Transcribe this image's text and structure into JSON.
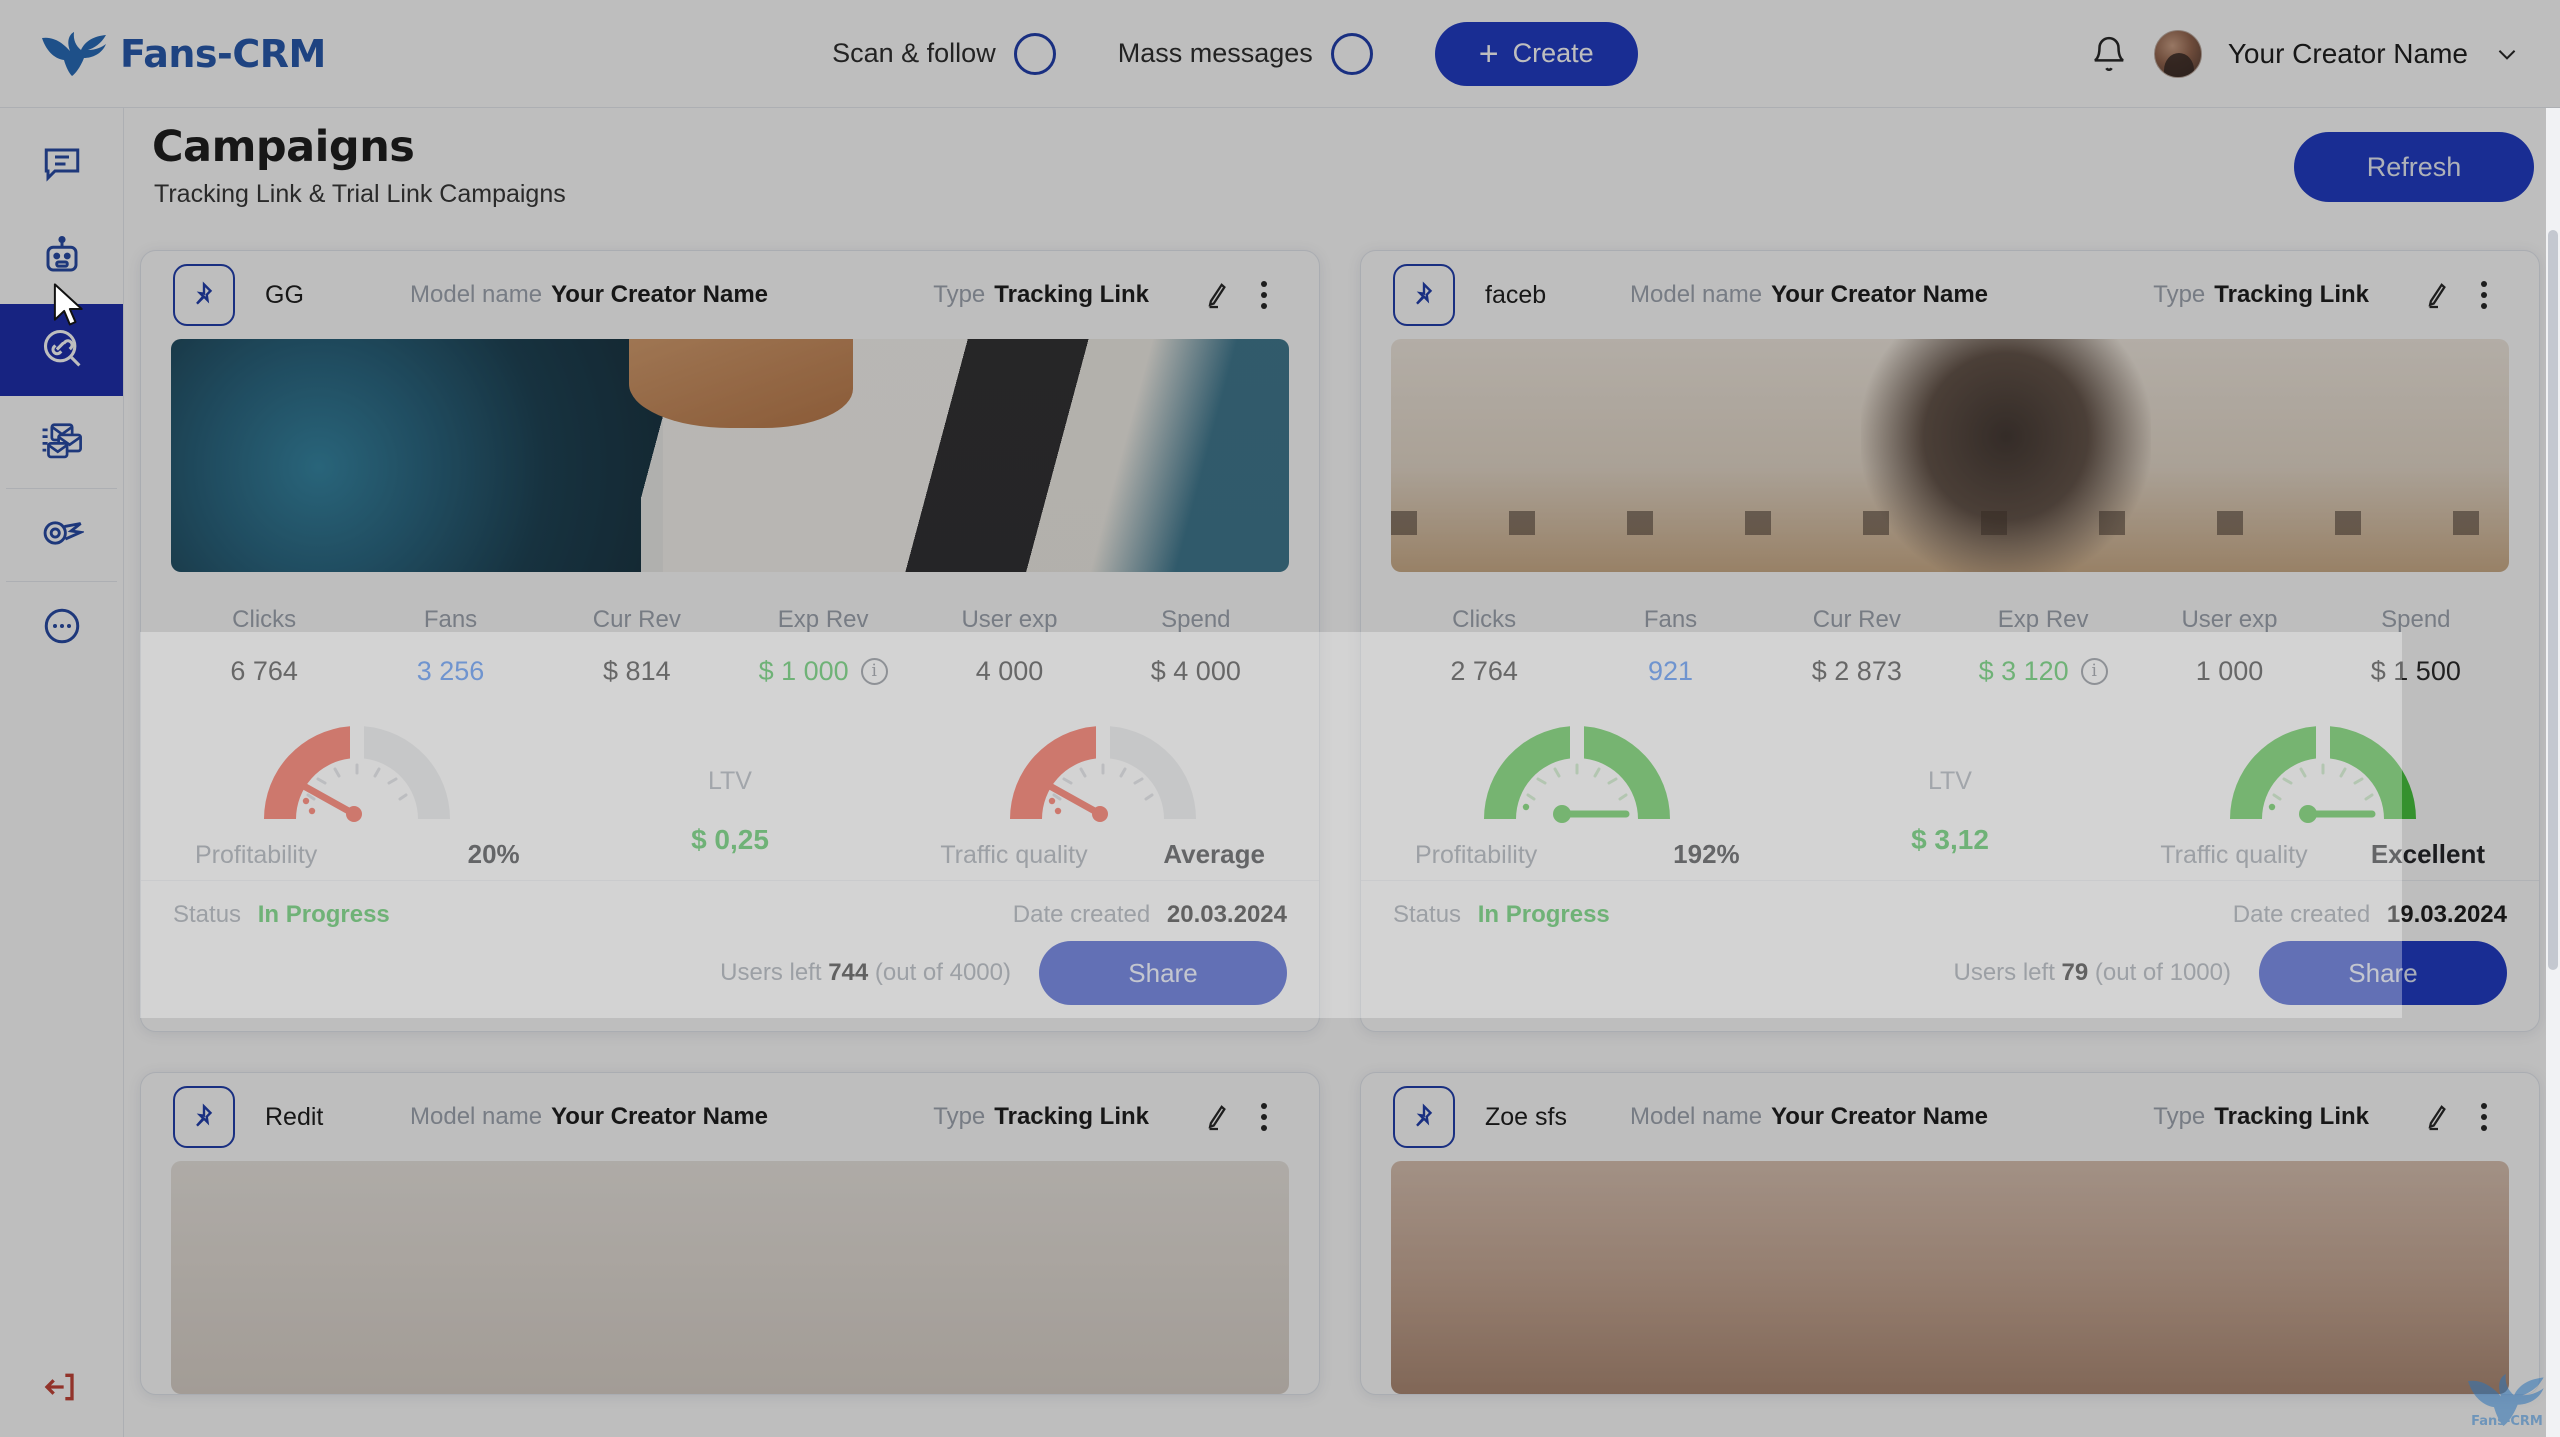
{
  "topbar": {
    "brand": "Fans-CRM",
    "brand_icon": "wings-logo-icon",
    "scan_follow_label": "Scan & follow",
    "mass_messages_label": "Mass messages",
    "create_label": "Create",
    "create_plus": "+",
    "bell_icon": "bell-icon",
    "user_name": "Your Creator Name",
    "chevron_icon": "chevron-down-icon",
    "accent_color": "#1430c2"
  },
  "sidebar": {
    "items": [
      {
        "icon": "chat-bubble-icon",
        "active": false
      },
      {
        "icon": "robot-icon",
        "active": false
      },
      {
        "icon": "link-search-icon",
        "active": true
      },
      {
        "icon": "mail-stack-icon",
        "active": false
      },
      {
        "icon": "comet-icon",
        "active": false
      },
      {
        "icon": "more-dots-circle-icon",
        "active": false
      }
    ],
    "logout_icon": "logout-arrow-icon"
  },
  "page": {
    "title": "Campaigns",
    "subtitle": "Tracking Link & Trial Link Campaigns",
    "refresh_label": "Refresh"
  },
  "labels": {
    "model_name": "Model name",
    "type": "Type",
    "clicks": "Clicks",
    "fans": "Fans",
    "cur_rev": "Cur Rev",
    "exp_rev": "Exp Rev",
    "user_exp": "User exp",
    "spend": "Spend",
    "profitability": "Profitability",
    "traffic_quality": "Traffic quality",
    "ltv": "LTV",
    "status": "Status",
    "date_created": "Date created",
    "users_left": "Users left",
    "share": "Share",
    "edit_icon": "pencil-edit-icon",
    "menu_icon": "more-vertical-icon",
    "pin_icon": "pin-bookmark-icon",
    "info_icon": "info-circle-icon"
  },
  "colors": {
    "green": "#2fbb3e",
    "red": "#f2402a",
    "blue_value": "#2f7bf6",
    "muted": "#9aa1ad"
  },
  "cards": [
    {
      "name": "GG",
      "model_name": "Your Creator Name",
      "type": "Tracking Link",
      "media": "gg",
      "metrics": {
        "clicks": "6 764",
        "fans": "3 256",
        "cur_rev": "$ 814",
        "exp_rev": "$ 1 000",
        "user_exp": "4 000",
        "spend": "$ 4 000"
      },
      "profitability_value": "20%",
      "profitability_pct": 20,
      "traffic_quality_value": "Average",
      "traffic_quality_pct": 20,
      "gauge_color": "#f2402a",
      "ltv": "$ 0,25",
      "status": "In Progress",
      "date_created": "20.03.2024",
      "users_left": "744",
      "users_total": "(out of 4000)"
    },
    {
      "name": "faceb",
      "model_name": "Your Creator Name",
      "type": "Tracking Link",
      "media": "fb",
      "metrics": {
        "clicks": "2 764",
        "fans": "921",
        "cur_rev": "$ 2 873",
        "exp_rev": "$ 3 120",
        "user_exp": "1 000",
        "spend": "$ 1 500"
      },
      "profitability_value": "192%",
      "profitability_pct": 100,
      "traffic_quality_value": "Excellent",
      "traffic_quality_pct": 100,
      "gauge_color": "#3cbf31",
      "ltv": "$ 3,12",
      "status": "In Progress",
      "date_created": "19.03.2024",
      "users_left": "79",
      "users_total": "(out of 1000)"
    },
    {
      "name": "Redit",
      "model_name": "Your Creator Name",
      "type": "Tracking Link",
      "media": "redit"
    },
    {
      "name": "Zoe sfs",
      "model_name": "Your Creator Name",
      "type": "Tracking Link",
      "media": "zoe"
    }
  ]
}
